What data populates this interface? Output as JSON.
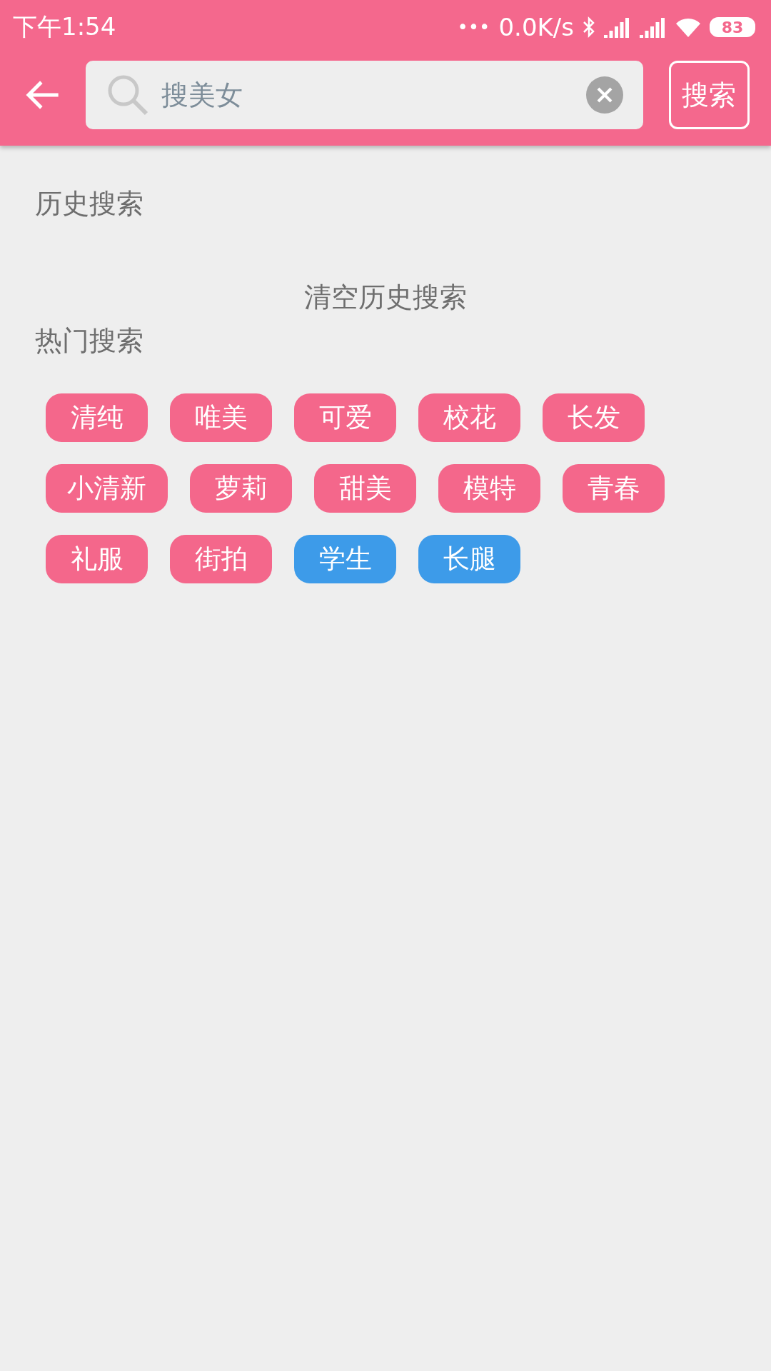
{
  "status_bar": {
    "time": "下午1:54",
    "dots": "•••",
    "speed": "0.0K/s",
    "battery": "83"
  },
  "search_bar": {
    "value": "搜美女",
    "button": "搜索"
  },
  "history": {
    "title": "历史搜索",
    "clear": "清空历史搜索"
  },
  "hot": {
    "title": "热门搜索",
    "tags": [
      {
        "label": "清纯",
        "color": "#f4678b"
      },
      {
        "label": "唯美",
        "color": "#f4678b"
      },
      {
        "label": "可爱",
        "color": "#f4678b"
      },
      {
        "label": "校花",
        "color": "#f4678b"
      },
      {
        "label": "长发",
        "color": "#f4678b"
      },
      {
        "label": "小清新",
        "color": "#f4678b"
      },
      {
        "label": "萝莉",
        "color": "#f4678b"
      },
      {
        "label": "甜美",
        "color": "#f4678b"
      },
      {
        "label": "模特",
        "color": "#f4678b"
      },
      {
        "label": "青春",
        "color": "#f4678b"
      },
      {
        "label": "礼服",
        "color": "#f4678b"
      },
      {
        "label": "街拍",
        "color": "#f4678b"
      },
      {
        "label": "学生",
        "color": "#3d9be9"
      },
      {
        "label": "长腿",
        "color": "#3d9be9"
      }
    ]
  }
}
